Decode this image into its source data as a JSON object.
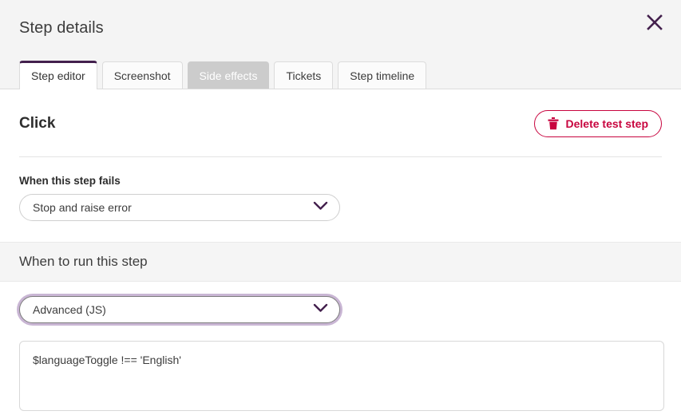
{
  "header": {
    "title": "Step details",
    "close_icon": "close-icon"
  },
  "tabs": [
    {
      "label": "Step editor",
      "state": "active"
    },
    {
      "label": "Screenshot",
      "state": "default"
    },
    {
      "label": "Side effects",
      "state": "disabled"
    },
    {
      "label": "Tickets",
      "state": "default"
    },
    {
      "label": "Step timeline",
      "state": "default"
    }
  ],
  "step": {
    "name": "Click",
    "delete_label": "Delete test step",
    "delete_icon": "trash-icon"
  },
  "on_fail": {
    "label": "When this step fails",
    "selected": "Stop and raise error",
    "chevron_icon": "chevron-down-icon"
  },
  "when_to_run": {
    "section_title": "When to run this step",
    "selected": "Advanced (JS)",
    "chevron_icon": "chevron-down-icon",
    "expression": "$languageToggle !== 'English'",
    "expression_placeholder": ""
  },
  "colors": {
    "accent_purple": "#43204d",
    "danger_red": "#c8053f",
    "focus_ring": "#c9b6d4",
    "band_gray": "#f5f5f5",
    "header_gray": "#f4f4f4",
    "disabled_gray": "#cccccc"
  }
}
